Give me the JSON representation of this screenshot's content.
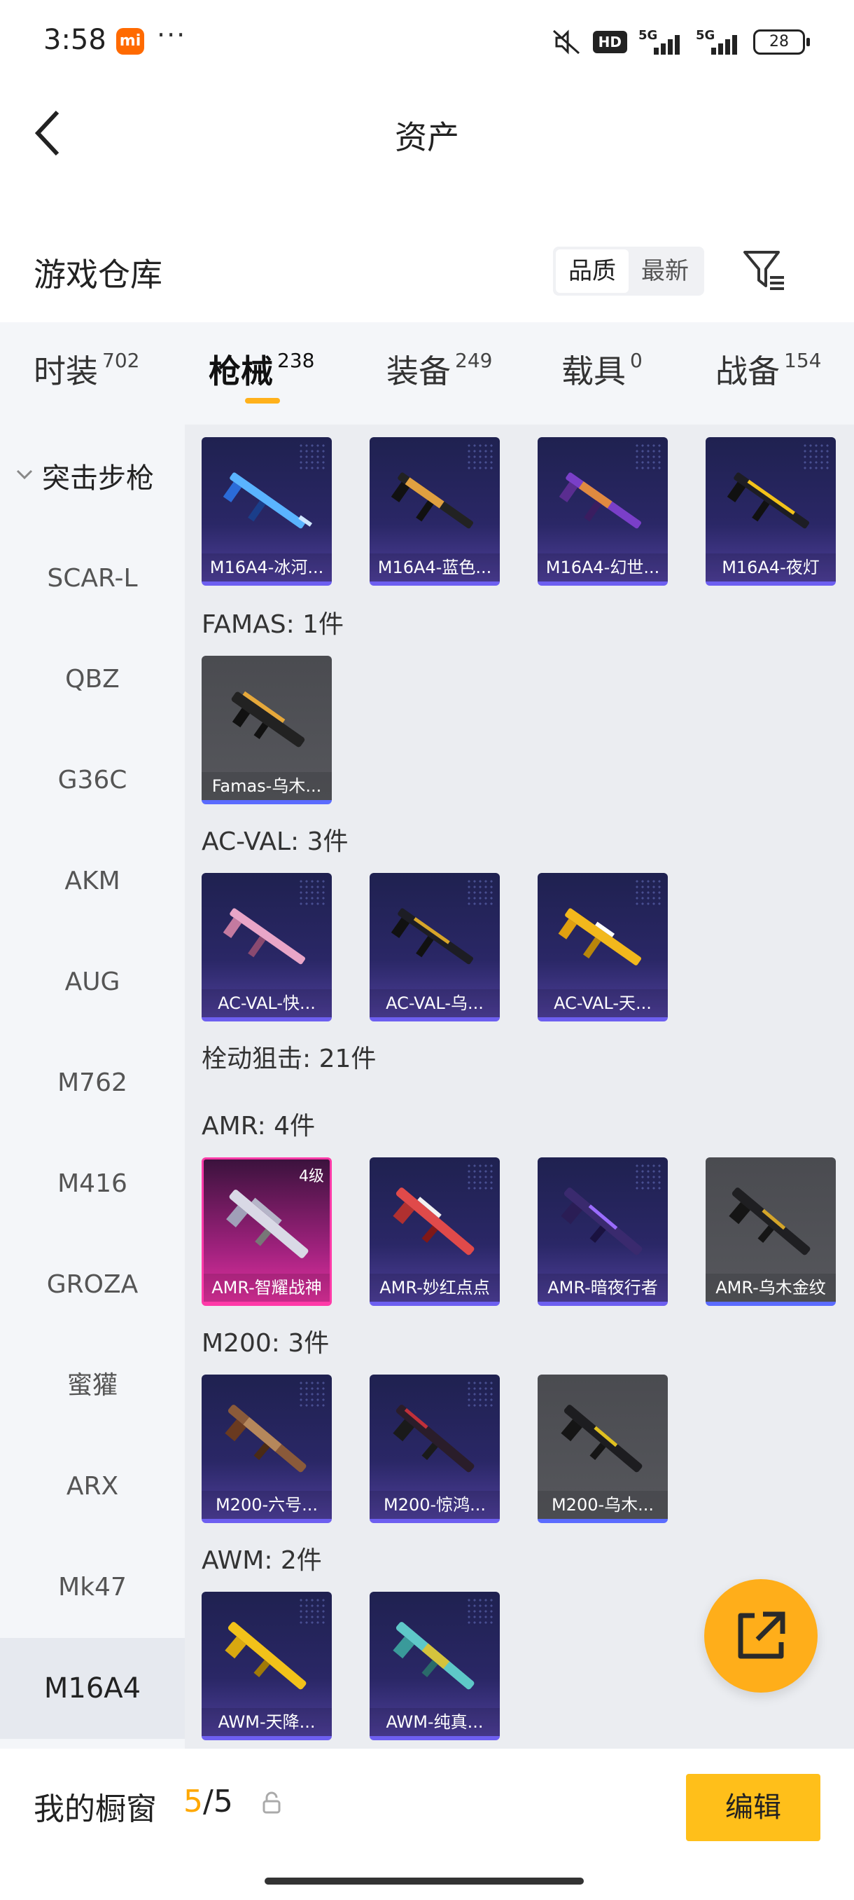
{
  "status_bar": {
    "time": "3:58",
    "mi_label": "mi",
    "dots": "···",
    "hd": "HD",
    "net1": "5G",
    "net2": "5G",
    "battery": "28"
  },
  "header": {
    "title": "资产"
  },
  "warehouse": {
    "title": "游戏仓库",
    "sort_options": [
      "品质",
      "最新"
    ],
    "active_sort": "品质"
  },
  "tabs": [
    {
      "label": "时装",
      "count": "702"
    },
    {
      "label": "枪械",
      "count": "238"
    },
    {
      "label": "装备",
      "count": "249"
    },
    {
      "label": "载具",
      "count": "0"
    },
    {
      "label": "战备",
      "count": "154"
    }
  ],
  "active_tab": "枪械",
  "sidebar": {
    "category": "突击步枪",
    "items": [
      "SCAR-L",
      "QBZ",
      "G36C",
      "AKM",
      "AUG",
      "M762",
      "M416",
      "GROZA",
      "蜜獾",
      "ARX",
      "Mk47",
      "M16A4"
    ],
    "active": "M16A4"
  },
  "groups": {
    "m16": {
      "cards": [
        "M16A4-冰河...",
        "M16A4-蓝色...",
        "M16A4-幻世...",
        "M16A4-夜灯"
      ]
    },
    "famas": {
      "title": "FAMAS: 1件",
      "cards": [
        "Famas-乌木..."
      ]
    },
    "acval": {
      "title": "AC-VAL: 3件",
      "cards": [
        "AC-VAL-快...",
        "AC-VAL-乌...",
        "AC-VAL-天..."
      ]
    },
    "sniper": {
      "title": "栓动狙击: 21件"
    },
    "amr": {
      "title": "AMR: 4件",
      "level": "4级",
      "cards": [
        "AMR-智耀战神",
        "AMR-妙红点点",
        "AMR-暗夜行者",
        "AMR-乌木金纹"
      ]
    },
    "m200": {
      "title": "M200: 3件",
      "cards": [
        "M200-六号...",
        "M200-惊鸿...",
        "M200-乌木..."
      ]
    },
    "awm": {
      "title": "AWM: 2件",
      "cards": [
        "AWM-天降...",
        "AWM-纯真..."
      ]
    }
  },
  "bottom_bar": {
    "label": "我的橱窗",
    "count_current": "5",
    "count_sep": "/",
    "count_total": "5",
    "edit_label": "编辑"
  },
  "colors": {
    "accent": "#ffb11b",
    "card_purple": "#2a2766",
    "card_grey": "#56575c",
    "card_pink": "#e2319e"
  }
}
